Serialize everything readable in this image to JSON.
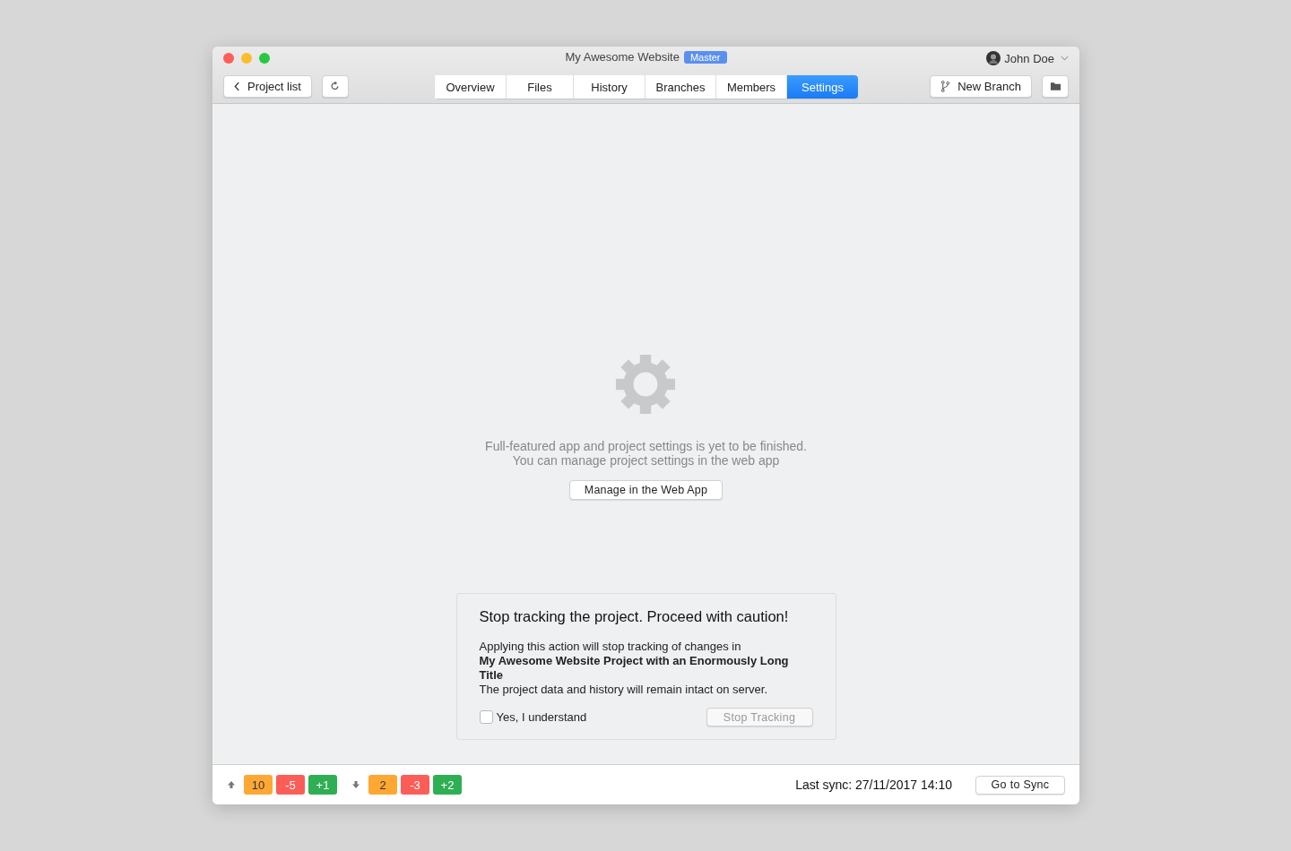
{
  "window": {
    "title": "My Awesome Website",
    "branch_badge": "Master",
    "user": "John Doe"
  },
  "toolbar": {
    "back_button": "Project list",
    "new_branch_button": "New Branch"
  },
  "tabs": [
    {
      "label": "Overview",
      "selected": false
    },
    {
      "label": "Files",
      "selected": false
    },
    {
      "label": "History",
      "selected": false
    },
    {
      "label": "Branches",
      "selected": false
    },
    {
      "label": "Members",
      "selected": false
    },
    {
      "label": "Settings",
      "selected": true
    }
  ],
  "placeholder_panel": {
    "message": "Full-featured app and project settings is yet to be finished.\nYou can manage project settings in the web app",
    "button": "Manage in the Web App"
  },
  "stop_tracking": {
    "title": "Stop tracking the project. Proceed with caution!",
    "text": "Applying this action will stop tracking of changes in\n**My Awesome Website Project with an Enormously Long Title**\nThe project data and history will remain intact on server.",
    "checkbox": {
      "label": "Yes, I understand",
      "checked": false
    },
    "button": {
      "label": "Stop Tracking",
      "disabled": true
    }
  },
  "status_bar": {
    "outgoing": [
      {
        "text": "10",
        "kind": "changed"
      },
      {
        "text": "-5",
        "kind": "removed"
      },
      {
        "text": "+1",
        "kind": "added"
      }
    ],
    "incoming": [
      {
        "text": "2",
        "kind": "changed"
      },
      {
        "text": "-3",
        "kind": "removed"
      },
      {
        "text": "+2",
        "kind": "added"
      }
    ],
    "last_sync": "Last sync: 27/11/2017 14:10",
    "sync_button": "Go to Sync"
  }
}
